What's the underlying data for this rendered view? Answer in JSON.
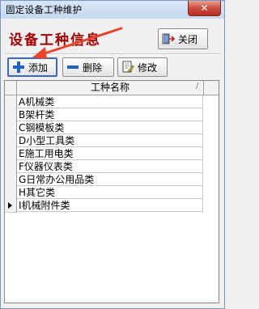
{
  "window": {
    "title": "固定设备工种维护",
    "close_glyph": "✕"
  },
  "heading": "设备工种信息",
  "buttons": {
    "close_label": "关闭",
    "add_label": "添加",
    "delete_label": "删除",
    "edit_label": "修改"
  },
  "grid": {
    "column_header": "工种名称",
    "rows": [
      "A机械类",
      "B架杆类",
      "C钢模板类",
      "D小型工具类",
      "E施工用电类",
      "F仪器仪表类",
      "G日常办公用品类",
      "H其它类",
      "I机械附件类"
    ],
    "current_row": 8
  },
  "colors": {
    "heading": "#a00000",
    "annotation_arrow": "#e8442c",
    "add_icon": "#1e5fcf"
  }
}
